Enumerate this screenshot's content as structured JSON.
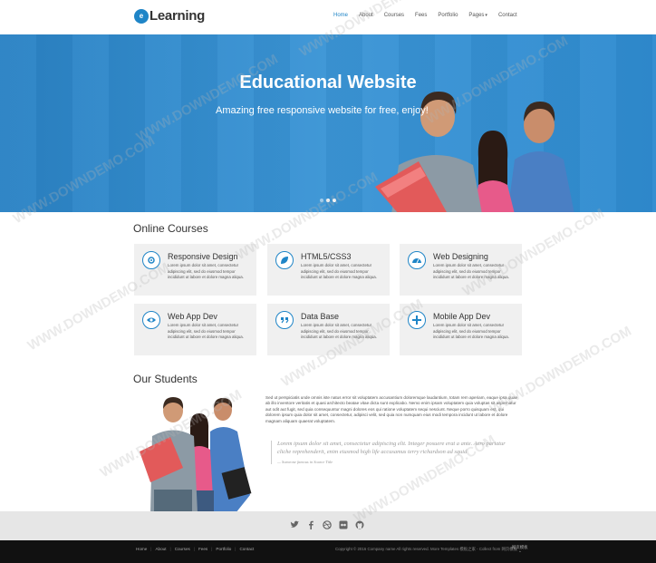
{
  "header": {
    "logo_mark": "e",
    "logo_text": "Learning",
    "nav": [
      "Home",
      "About",
      "Courses",
      "Fees",
      "Portfolio",
      "Pages",
      "Contact"
    ]
  },
  "hero": {
    "title": "Educational Website",
    "subtitle": "Amazing free responsive website for free, enjoy!"
  },
  "courses": {
    "heading": "Online Courses",
    "desc": "Lorem ipsum dolor sit amet, consectetur adipiscing elit, sed do eiusmod tempor incididunt ut labore et dolore magna aliqua.",
    "items": [
      {
        "title": "Responsive Design",
        "icon": "gears-icon"
      },
      {
        "title": "HTML5/CSS3",
        "icon": "leaf-icon"
      },
      {
        "title": "Web Designing",
        "icon": "dashboard-icon"
      },
      {
        "title": "Web App Dev",
        "icon": "eye-icon"
      },
      {
        "title": "Data Base",
        "icon": "quote-icon"
      },
      {
        "title": "Mobile App Dev",
        "icon": "plus-icon"
      }
    ]
  },
  "students": {
    "heading": "Our Students",
    "paragraph": "Sed ut perspiciatis unde omnis iste natus error sit voluptatem accusantium doloremque laudantium, totam rem aperiam, eaque ipsa quae ab illo inventore veritatis et quasi architecto beatae vitae dicta sunt explicabo. Nemo enim ipsam voluptatem quia voluptas sit aspernatur aut odit aut fugit, sed quia consequuntur magni dolores eos qui ratione voluptatem sequi nesciunt. Neque porro quisquam est, qui dolorem ipsum quia dolor sit amet, consectetur, adipisci velit, sed quia non numquam eius modi tempora incidunt ut labore et dolore magnam aliquam quaerat voluptatem.",
    "quote": "Lorem ipsum dolor sit amet, consectetur adipiscing elit. Integer posuere erat a ante. Aero pariatur cliche reprehenderit, enim eiusmod high life accusamus terry richardson ad squid",
    "quote_source": "— Someone famous in Source Title"
  },
  "social_icons": [
    "twitter-icon",
    "facebook-icon",
    "dribbble-icon",
    "flickr-icon",
    "github-icon"
  ],
  "footer": {
    "nav": [
      "Home",
      "About",
      "Courses",
      "Fees",
      "Portfolio",
      "Contact"
    ],
    "copyright": "Copyright © 2016 Company name All rights reserved. More Templates 模板之家 - Collect from 网页模板",
    "note": "网页模板"
  },
  "watermark": "WWW.DOWNDEMO.COM",
  "colors": {
    "accent": "#1f85c7",
    "footer": "#111111",
    "social_bar": "#e6e6e6"
  }
}
